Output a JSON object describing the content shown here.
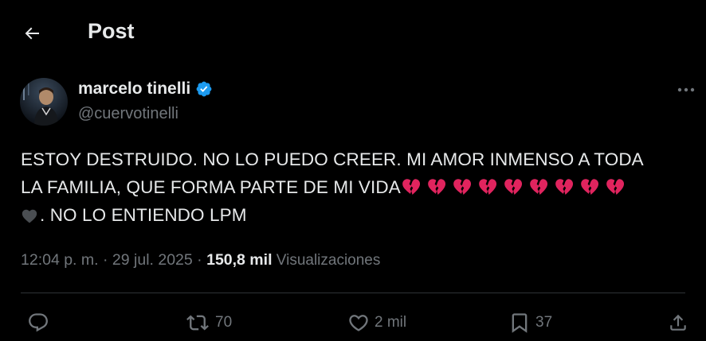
{
  "header": {
    "title": "Post",
    "back_icon": "arrow-left-icon"
  },
  "author": {
    "name": "marcelo tinelli",
    "handle": "@cuervotinelli",
    "verified_color": "#1d9bf0"
  },
  "tweet": {
    "line1": "ESTOY DESTRUIDO. NO LO PUEDO CREER. MI AMOR INMENSO A TODA",
    "line2": "LA FAMILIA, QUE FORMA PARTE DE MI VIDA",
    "line3": ". NO LO ENTIENDO LPM",
    "broken_heart_count": 9,
    "broken_heart_color": "#e0245e",
    "black_heart_color": "#4a4e52"
  },
  "meta": {
    "time": "12:04 p. m.",
    "sep1": " · ",
    "date": "29 jul. 2025",
    "sep2": " · ",
    "views_count": "150,8 mil",
    "views_label": " Visualizaciones"
  },
  "actions": {
    "reply": {
      "icon": "reply-icon",
      "count": ""
    },
    "retweet": {
      "icon": "retweet-icon",
      "count": "70"
    },
    "like": {
      "icon": "heart-icon",
      "count": "2 mil"
    },
    "bookmark": {
      "icon": "bookmark-icon",
      "count": "37"
    },
    "share": {
      "icon": "share-icon",
      "count": ""
    }
  },
  "colors": {
    "background": "#000000",
    "text": "#e7e9ea",
    "secondary": "#71767b",
    "divider": "#2f3336"
  }
}
